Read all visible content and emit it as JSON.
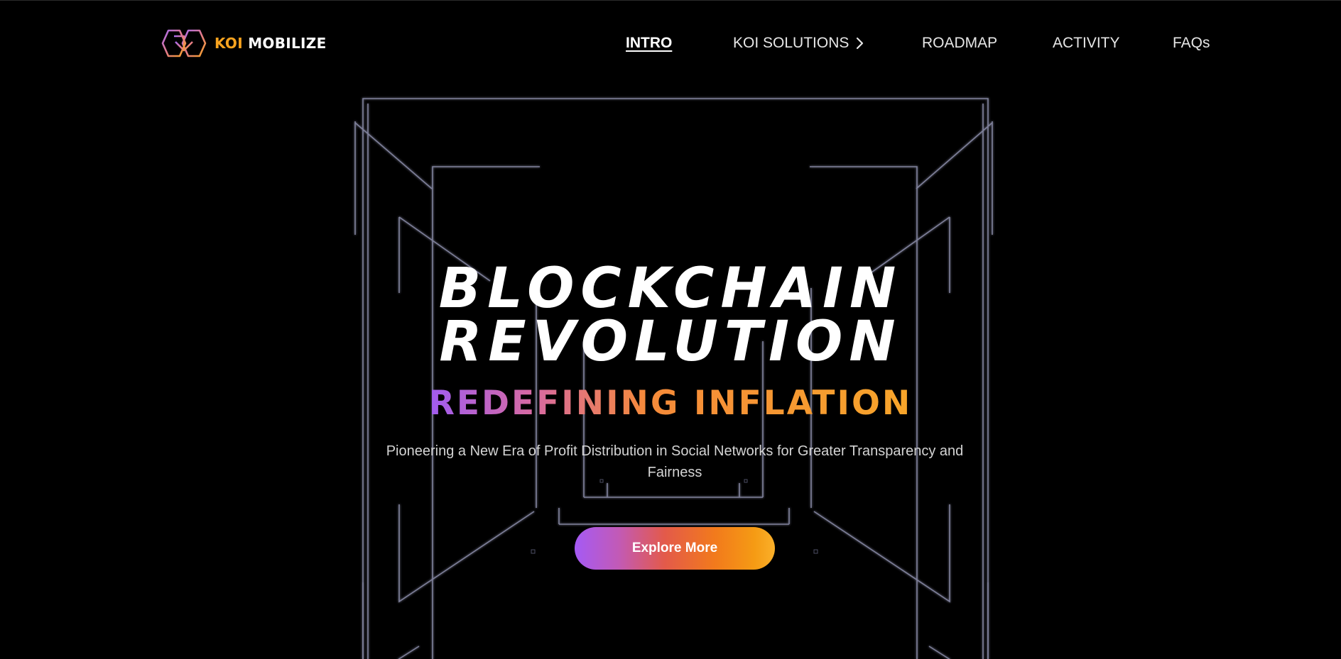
{
  "brand": {
    "logo_icon": "hexagon-koi-logo-icon",
    "name_part1": "KOI",
    "name_part2": "MOBILIZE",
    "accent_color": "#f7a31f"
  },
  "nav": {
    "items": [
      {
        "label": "INTRO",
        "active": true
      },
      {
        "label": "KOI SOLUTIONS",
        "icon": "chevron-right-icon"
      },
      {
        "label": "ROADMAP"
      },
      {
        "label": "ACTIVITY"
      },
      {
        "label": "FAQs"
      }
    ]
  },
  "hero": {
    "title_line1": "BLOCKCHAIN",
    "title_line2": "REVOLUTION",
    "subtitle": "REDEFINING INFLATION",
    "description": "Pioneering a New Era of Profit Distribution in Social Networks for Greater Transparency and Fairness",
    "cta_label": "Explore More",
    "gradient_start": "#a55af5",
    "gradient_end": "#fbb02a"
  }
}
